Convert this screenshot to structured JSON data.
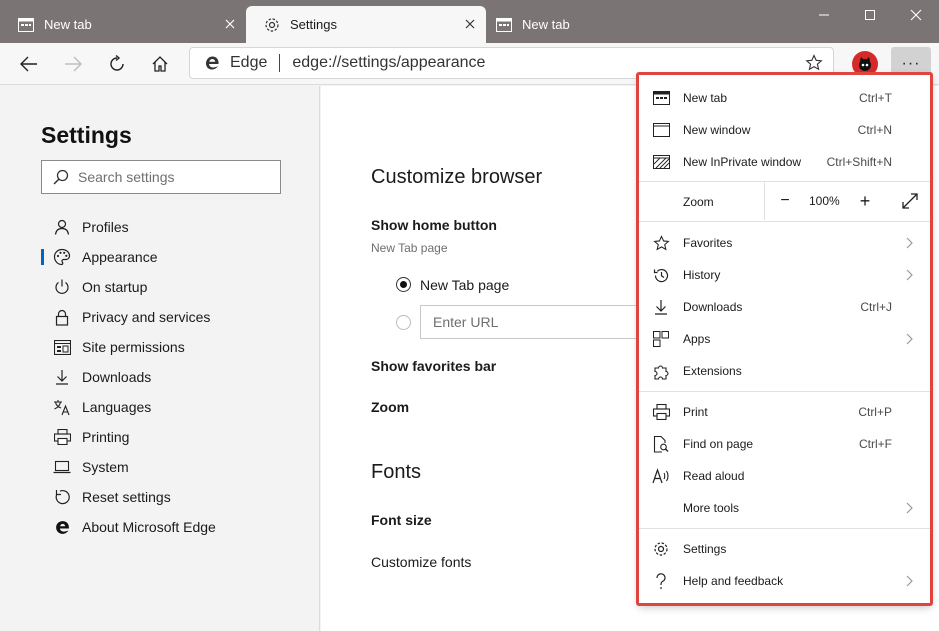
{
  "tabs": [
    {
      "title": "New tab",
      "icon": "new-tab-icon"
    },
    {
      "title": "Settings",
      "icon": "gear-icon"
    },
    {
      "title": "New tab",
      "icon": "new-tab-icon"
    }
  ],
  "address": {
    "brand": "Edge",
    "url": "edge://settings/appearance"
  },
  "more_button_label": "···",
  "sidebar": {
    "title": "Settings",
    "search_placeholder": "Search settings",
    "items": [
      {
        "label": "Profiles",
        "icon": "person-icon",
        "selected": false
      },
      {
        "label": "Appearance",
        "icon": "palette-icon",
        "selected": true
      },
      {
        "label": "On startup",
        "icon": "power-icon",
        "selected": false
      },
      {
        "label": "Privacy and services",
        "icon": "lock-icon",
        "selected": false
      },
      {
        "label": "Site permissions",
        "icon": "site-permissions-icon",
        "selected": false
      },
      {
        "label": "Downloads",
        "icon": "download-icon",
        "selected": false
      },
      {
        "label": "Languages",
        "icon": "languages-icon",
        "selected": false
      },
      {
        "label": "Printing",
        "icon": "printer-icon",
        "selected": false
      },
      {
        "label": "System",
        "icon": "laptop-icon",
        "selected": false
      },
      {
        "label": "Reset settings",
        "icon": "reset-icon",
        "selected": false
      },
      {
        "label": "About Microsoft Edge",
        "icon": "edge-logo-icon",
        "selected": false
      }
    ]
  },
  "main": {
    "customize_title": "Customize browser",
    "home_button_label": "Show home button",
    "home_button_sub": "New Tab page",
    "radio_newtab_label": "New Tab page",
    "url_placeholder": "Enter URL",
    "favorites_bar_label": "Show favorites bar",
    "zoom_label": "Zoom",
    "fonts_title": "Fonts",
    "font_size_label": "Font size",
    "customize_fonts_label": "Customize fonts"
  },
  "menu": {
    "items": [
      {
        "label": "New tab",
        "shortcut": "Ctrl+T",
        "icon": "new-tab-icon"
      },
      {
        "label": "New window",
        "shortcut": "Ctrl+N",
        "icon": "new-window-icon"
      },
      {
        "label": "New InPrivate window",
        "shortcut": "Ctrl+Shift+N",
        "icon": "inprivate-icon"
      },
      {
        "label": "Favorites",
        "icon": "star-icon",
        "submenu": true
      },
      {
        "label": "History",
        "icon": "history-icon",
        "submenu": true
      },
      {
        "label": "Downloads",
        "shortcut": "Ctrl+J",
        "icon": "download-icon"
      },
      {
        "label": "Apps",
        "icon": "apps-icon",
        "submenu": true
      },
      {
        "label": "Extensions",
        "icon": "puzzle-icon"
      },
      {
        "label": "Print",
        "shortcut": "Ctrl+P",
        "icon": "printer-icon"
      },
      {
        "label": "Find on page",
        "shortcut": "Ctrl+F",
        "icon": "find-icon"
      },
      {
        "label": "Read aloud",
        "icon": "read-aloud-icon"
      },
      {
        "label": "More tools",
        "icon": "",
        "submenu": true
      },
      {
        "label": "Settings",
        "icon": "gear-icon"
      },
      {
        "label": "Help and feedback",
        "icon": "help-icon",
        "submenu": true
      }
    ],
    "zoom": {
      "label": "Zoom",
      "minus": "−",
      "value": "100%",
      "plus": "+"
    }
  },
  "colors": {
    "accent": "#0067c0",
    "highlight": "#e0443e",
    "titlebar": "#7a7574"
  }
}
